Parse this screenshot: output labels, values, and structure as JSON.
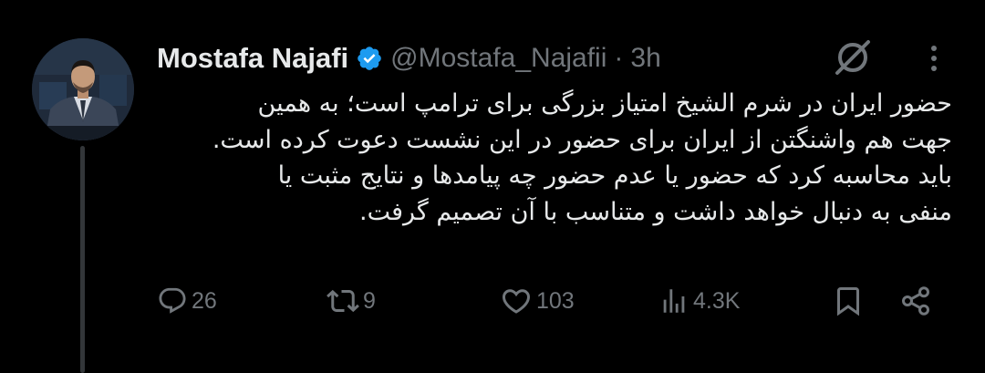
{
  "tweet": {
    "author_name": "Mostafa Najafi",
    "handle": "@Mostafa_Najafii",
    "separator": "·",
    "time": "3h",
    "verified": true,
    "avatar": "avatar-photo",
    "text_lines": [
      "حضور ایران در شرم الشیخ امتیاز بزرگی برای ترامپ است؛ به همین",
      "جهت هم واشنگتن از ایران برای حضور در این نشست دعوت کرده است.",
      "باید محاسبه کرد که حضور یا عدم حضور چه پیامدها و نتایج مثبت یا",
      "منفی به دنبال خواهد داشت و متناسب با آن تصمیم گرفت."
    ]
  },
  "actions": {
    "replies": "26",
    "reposts": "9",
    "likes": "103",
    "views": "4.3K"
  },
  "icons": {
    "verified": "verified-badge-icon",
    "grok": "grok-icon",
    "more": "more-options-icon",
    "reply": "reply-icon",
    "repost": "repost-icon",
    "like": "like-icon",
    "views": "views-icon",
    "bookmark": "bookmark-icon",
    "share": "share-icon"
  },
  "colors": {
    "background": "#000000",
    "text": "#e7e9ea",
    "muted": "#71767b",
    "verified": "#1d9bf0",
    "thread_line": "#333639"
  }
}
